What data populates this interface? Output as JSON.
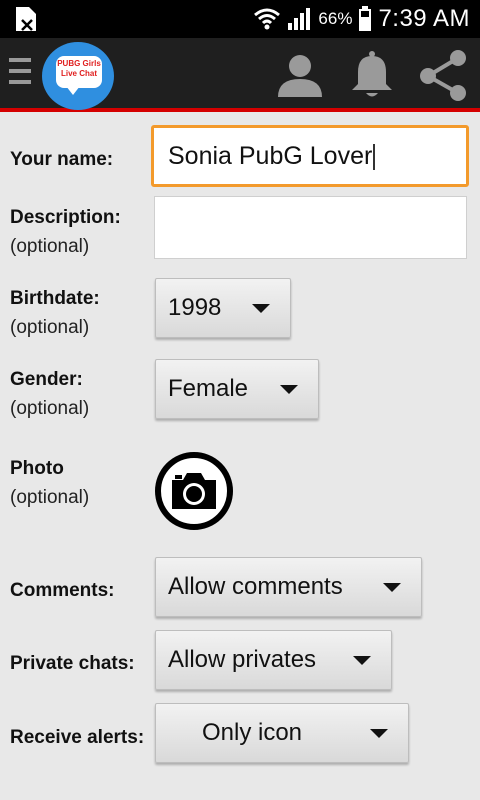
{
  "status_bar": {
    "battery_percent": "66%",
    "time": "7:39 AM",
    "icons": [
      "sim-icon",
      "wifi-icon",
      "signal-icon",
      "battery-icon"
    ]
  },
  "app_bar": {
    "logo_text": "PUBG Girls Live Chat",
    "icons": [
      "menu-icon",
      "profile-icon",
      "bell-icon",
      "share-icon"
    ]
  },
  "form": {
    "name": {
      "label": "Your name:",
      "value": "Sonia PubG Lover"
    },
    "description": {
      "label": "Description:",
      "optional": "(optional)",
      "value": ""
    },
    "birthdate": {
      "label": "Birthdate:",
      "optional": "(optional)",
      "value": "1998"
    },
    "gender": {
      "label": "Gender:",
      "optional": "(optional)",
      "value": "Female"
    },
    "photo": {
      "label": "Photo",
      "optional": "(optional)"
    },
    "comments": {
      "label": "Comments:",
      "value": "Allow comments"
    },
    "private_chats": {
      "label": "Private chats:",
      "value": "Allow privates"
    },
    "receive_alerts": {
      "label": "Receive alerts:",
      "value": "Only icon"
    }
  },
  "colors": {
    "accent_focus": "#f39a2c",
    "app_bar": "#1f1f1f",
    "red_line": "#d40000",
    "logo_bg": "#2f8fe0"
  }
}
